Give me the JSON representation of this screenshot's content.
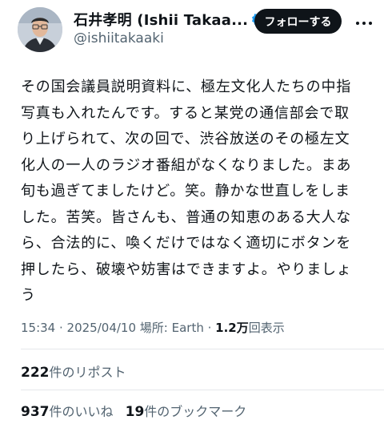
{
  "author": {
    "display_name": "石井孝明 (Ishii Takaa...",
    "handle": "@ishiitakaaki",
    "verified_icon": "verified-badge-icon",
    "badge_color": "#1d9bf0"
  },
  "follow_button_label": "フォローする",
  "tweet": {
    "text": "その国会議員説明資料に、極左文化人たちの中指\n写真も入れたんです。すると某党の通信部会で取\nり上げられて、次の回で、渋谷放送のその極左文\n化人の一人のラジオ番組がなくなりました。まあ\n旬も過ぎてましたけど。笑。静かな世直しをしま\nした。苦笑。皆さんも、普通の知恵のある大人な\nら、合法的に、喚くだけではなく適切にボタンを\n押したら、破壊や妨害はできますよ。やりましょ\nう"
  },
  "meta": {
    "time": "15:34",
    "sep1": " · ",
    "date": "2025/04/10",
    "sep2": " ",
    "location": "場所: Earth",
    "sep3": " · ",
    "views_count": "1.2万",
    "views_label": "回表示"
  },
  "stats": {
    "reposts_count": "222",
    "reposts_label": "件のリポスト",
    "likes_count": "937",
    "likes_label": "件のいいね",
    "bookmarks_count": "19",
    "bookmarks_label": "件のブックマーク"
  }
}
